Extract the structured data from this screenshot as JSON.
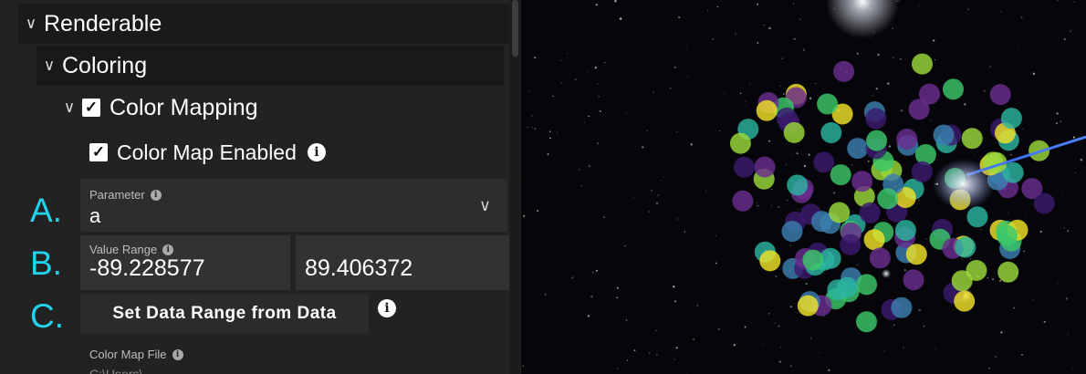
{
  "panel": {
    "renderable": {
      "label": "Renderable",
      "icon": "chevron-down-icon"
    },
    "coloring": {
      "label": "Coloring",
      "icon": "chevron-down-icon"
    },
    "color_mapping": {
      "label": "Color Mapping",
      "checked": true
    },
    "color_map_enabled": {
      "label": "Color Map Enabled",
      "checked": true,
      "icon": "info-icon"
    },
    "parameter": {
      "label": "Parameter",
      "value": "a",
      "icon": "chevron-down-icon"
    },
    "value_range": {
      "label": "Value Range",
      "min": "-89.228577",
      "max": "89.406372"
    },
    "set_range_button": {
      "label": "Set Data Range from Data"
    },
    "color_map_file": {
      "label": "Color Map File",
      "value": "C:\\Users\\..."
    }
  },
  "annotations": {
    "a": "A.",
    "b": "B.",
    "c": "C."
  },
  "colors": {
    "accent_annotation": "#22d3ee",
    "panel_bg": "#222222",
    "space_bg": "#06060a",
    "point_palette": [
      "#3b1a6e",
      "#6a2d8f",
      "#3a7fb0",
      "#2bb5a0",
      "#3ac76a",
      "#9bd93a",
      "#f0e22a"
    ]
  }
}
